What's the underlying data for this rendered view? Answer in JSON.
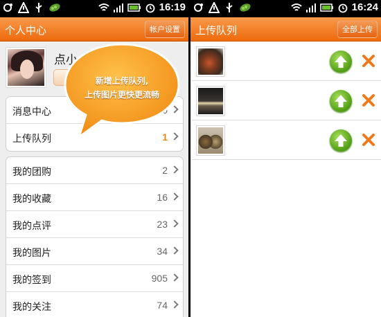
{
  "left_screen": {
    "status": {
      "time": "16:19"
    },
    "titlebar": {
      "title": "个人中心",
      "button_label": "帐户设置"
    },
    "profile": {
      "name": "点小"
    },
    "bubble": {
      "line1": "新增上传队列,",
      "line2": "上传图片更快更流畅"
    },
    "group1": [
      {
        "label": "消息中心",
        "value": "0"
      },
      {
        "label": "上传队列",
        "value": "1"
      }
    ],
    "group2": [
      {
        "label": "我的团购",
        "value": "2"
      },
      {
        "label": "我的收藏",
        "value": "16"
      },
      {
        "label": "我的点评",
        "value": "23"
      },
      {
        "label": "我的图片",
        "value": "34"
      },
      {
        "label": "我的签到",
        "value": "905"
      },
      {
        "label": "我的关注",
        "value": "74"
      }
    ]
  },
  "right_screen": {
    "status": {
      "time": "16:24"
    },
    "titlebar": {
      "title": "上传队列",
      "button_label": "全部上传"
    },
    "queue": [
      {
        "thumb": "food-photo"
      },
      {
        "thumb": "night-scene-photo"
      },
      {
        "thumb": "table-dishes-photo"
      }
    ]
  },
  "colors": {
    "accent": "#ee6a0d",
    "highlight_value": "#e8840f",
    "upload_green": "#4f9d14",
    "remove_orange": "#f07a1a"
  }
}
